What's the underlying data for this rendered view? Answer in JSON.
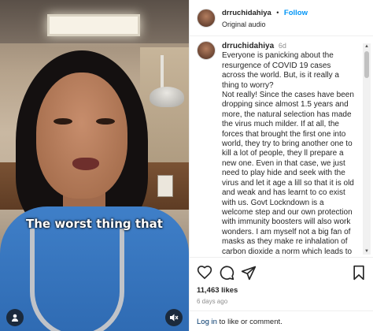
{
  "video": {
    "caption": "The worst thing that"
  },
  "header": {
    "username": "drruchidahiya",
    "separator": "•",
    "follow_label": "Follow",
    "audio": "Original audio"
  },
  "comment": {
    "username": "drruchidahiya",
    "time": "6d",
    "text": "Everyone is panicking about the resurgence of COVID 19 cases across the world. But, is it really a thing to worry?\nNot really! Since the cases have been dropping since almost 1.5 years and more, the natural selection has made the virus much milder. If at all, the forces that brought the first one into world, they try to bring another one to kill a lot of people, they ll prepare a new one. Even in that case, we just need to play hide and seek with the virus and let it age a lill so that it is old and weak and has learnt to co exist with us. Govt Lockndown is a welcome step and our own protection with immunity boosters will also work wonders. I am myself not a big fan of masks as they make re inhalation of carbon dioxide a norm which leads to"
  },
  "stats": {
    "likes": "11,463 likes",
    "ago": "6 days ago"
  },
  "footer": {
    "login_label": "Log in",
    "rest": " to like or comment."
  },
  "icons": {
    "like": "heart-icon",
    "comment": "comment-icon",
    "share": "share-icon",
    "save": "bookmark-icon",
    "audio": "audio-icon",
    "mute": "speaker-muted-icon"
  }
}
